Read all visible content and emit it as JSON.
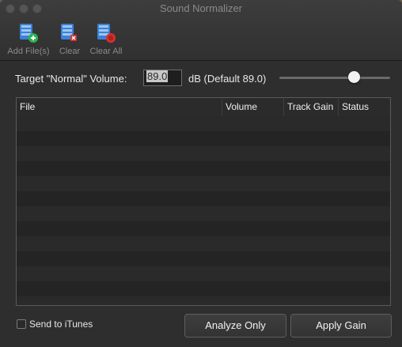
{
  "window": {
    "title": "Sound Normalizer"
  },
  "toolbar": {
    "items": [
      {
        "label": "Add File(s)",
        "icon": "add-file-icon",
        "badge_color": "#2db54a"
      },
      {
        "label": "Clear",
        "icon": "clear-icon",
        "badge_color": "#d9322a"
      },
      {
        "label": "Clear All",
        "icon": "clear-all-icon",
        "badge_color": "#d9322a"
      }
    ]
  },
  "target": {
    "label": "Target \"Normal\" Volume:",
    "value": "89.0",
    "unit_label": "dB (Default 89.0)",
    "slider_level": 0.62
  },
  "table": {
    "columns": [
      "File",
      "Volume",
      "Track Gain",
      "Status"
    ],
    "rows": []
  },
  "footer": {
    "send_to_itunes_label": "Send to iTunes",
    "send_to_itunes_checked": false,
    "analyze_button": "Analyze Only",
    "apply_button": "Apply Gain"
  },
  "colors": {
    "window_bg": "#2e2e2e",
    "icon_blue": "#3b82d8"
  }
}
